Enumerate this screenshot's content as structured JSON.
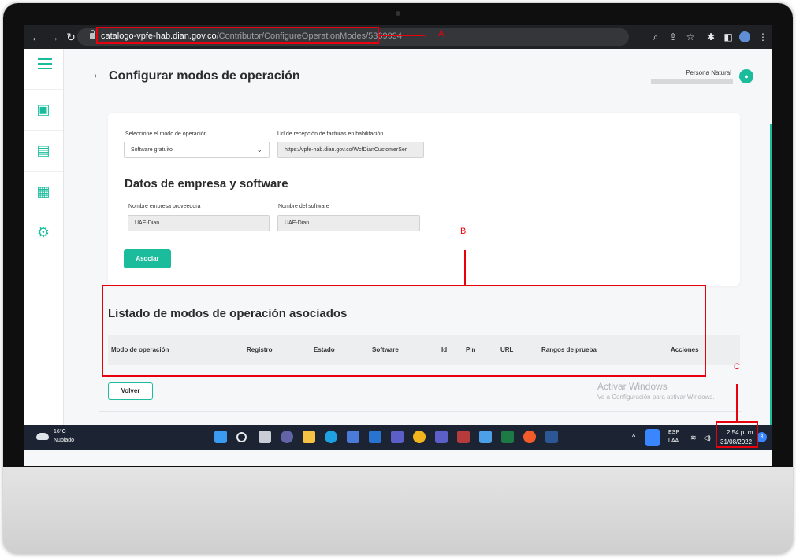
{
  "browser": {
    "url_host": "catalogo-vpfe-hab.dian.gov.co",
    "url_path": "/Contributor/ConfigureOperationModes/5369994",
    "icons": [
      "back-arrow-icon",
      "forward-arrow-icon",
      "reload-icon",
      "zoom-icon",
      "share-icon",
      "star-icon",
      "extensions-icon",
      "sidepanel-icon",
      "profile-icon",
      "menu-icon"
    ]
  },
  "header": {
    "title": "Configurar modos de operación",
    "back_icon": "←",
    "user_label": "Persona Natural"
  },
  "form": {
    "mode_label": "Seleccione el modo de operación",
    "mode_value": "Software gratuito",
    "url_label": "Url de recepción de facturas en habilitación",
    "url_value": "https://vpfe-hab.dian.gov.co/WcfDianCustomerSer",
    "company_section_title": "Datos de empresa y software",
    "provider_label": "Nombre empresa proveedora",
    "provider_value": "UAE-Dian",
    "software_label": "Nombre del software",
    "software_value": "UAE-Dian",
    "associate_button": "Asociar"
  },
  "list": {
    "title": "Listado de modos de operación asociados",
    "columns": [
      "Modo de operación",
      "Registro",
      "Estado",
      "Software",
      "Id",
      "Pin",
      "URL",
      "Rangos de prueba",
      "Acciones"
    ],
    "back_button": "Volver"
  },
  "watermark": {
    "line1": "Activar Windows",
    "line2": "Ve a Configuración para activar Windows."
  },
  "taskbar": {
    "temperature": "16°C",
    "weather": "Nublado",
    "language": "ESP",
    "layout": "LAA",
    "time": "2:54 p. m.",
    "date": "31/08/2022",
    "notifications": "3"
  },
  "annotations": {
    "a": "A",
    "b": "B",
    "c": "C"
  },
  "colors": {
    "accent": "#1abc9c",
    "annotation": "#e8000d",
    "chrome_bg": "#202124",
    "taskbar_bg": "#1c2433"
  }
}
